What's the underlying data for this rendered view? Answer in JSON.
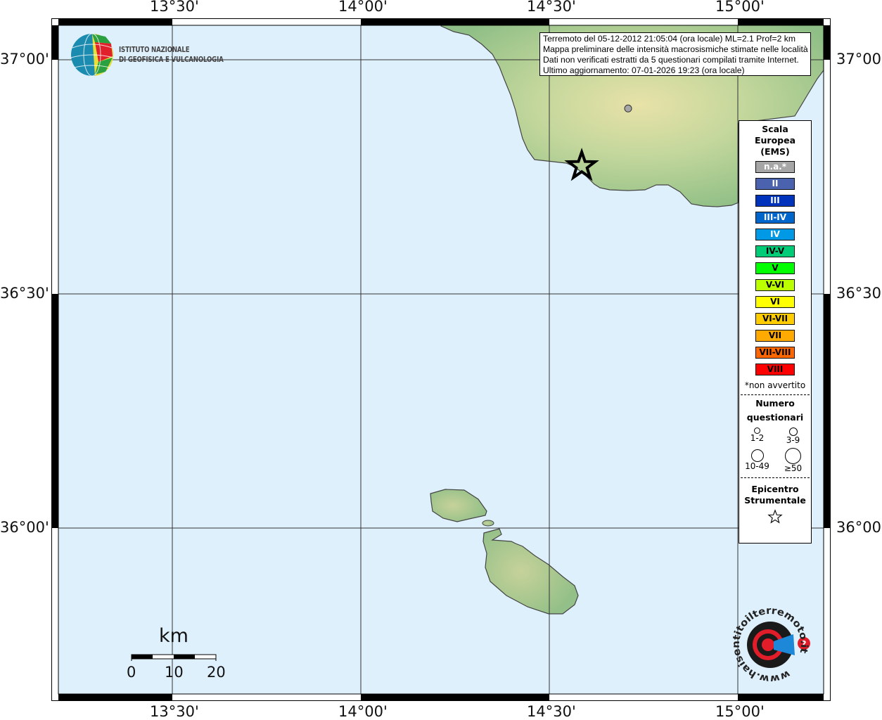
{
  "map": {
    "lon_ticks": [
      "13°30'",
      "14°00'",
      "14°30'",
      "15°00'"
    ],
    "lon_values": [
      13.5,
      14.0,
      14.5,
      15.0
    ],
    "lat_ticks": [
      "37°00'",
      "36°30'",
      "36°00'"
    ],
    "lat_values": [
      37.0,
      36.5,
      36.0
    ],
    "sea_color": "#dff0fd",
    "land_color": "#9cc48a",
    "epicenter": {
      "lon": 14.586,
      "lat": 36.773,
      "icon": "star-icon"
    },
    "localities": [
      {
        "lon": 14.709,
        "lat": 36.896,
        "intensity": "n.a.*",
        "color": "#a6a6a6"
      }
    ]
  },
  "logo": {
    "line1": "ISTITUTO NAZIONALE",
    "line2": "DI GEOFISICA E VULCANOLOGIA"
  },
  "info": {
    "line1": "Terremoto del 05-12-2012 21:05:04 (ora locale) ML=2.1 Prof=2 km",
    "line2": "Mappa preliminare delle intensità macrosismiche stimate nelle località",
    "line3": "Dati non verificati estratti da 5 questionari compilati tramite Internet.",
    "line4": "Ultimo aggiornamento: 07-01-2026 19:23 (ora locale)"
  },
  "legend": {
    "title1": "Scala",
    "title2": "Europea",
    "title3": "(EMS)",
    "scale": [
      {
        "label": "n.a.*",
        "color": "#a6a6a6",
        "text": "#ffffff"
      },
      {
        "label": "II",
        "color": "#4b63ae",
        "text": "#ffffff"
      },
      {
        "label": "III",
        "color": "#0033bb",
        "text": "#ffffff"
      },
      {
        "label": "III-IV",
        "color": "#0066cc",
        "text": "#ffffff"
      },
      {
        "label": "IV",
        "color": "#0099e6",
        "text": "#ffffff"
      },
      {
        "label": "IV-V",
        "color": "#00cc77",
        "text": "#000000"
      },
      {
        "label": "V",
        "color": "#00ff00",
        "text": "#000000"
      },
      {
        "label": "V-VI",
        "color": "#bbff00",
        "text": "#000000"
      },
      {
        "label": "VI",
        "color": "#ffff00",
        "text": "#000000"
      },
      {
        "label": "VI-VII",
        "color": "#ffcc00",
        "text": "#000000"
      },
      {
        "label": "VII",
        "color": "#ffaa00",
        "text": "#000000"
      },
      {
        "label": "VII-VIII",
        "color": "#ff6600",
        "text": "#000000"
      },
      {
        "label": "VIII",
        "color": "#ff0000",
        "text": "#000000"
      }
    ],
    "note": "*non avvertito",
    "count_title1": "Numero",
    "count_title2": "questionari",
    "counts": [
      "1-2",
      "3-9",
      "10-49",
      "≥50"
    ],
    "epi_title1": "Epicentro",
    "epi_title2": "Strumentale"
  },
  "scalebar": {
    "unit": "km",
    "labels": [
      "0",
      "10",
      "20"
    ]
  },
  "brand": {
    "text": "www.haisentitoilterremoto.it"
  }
}
